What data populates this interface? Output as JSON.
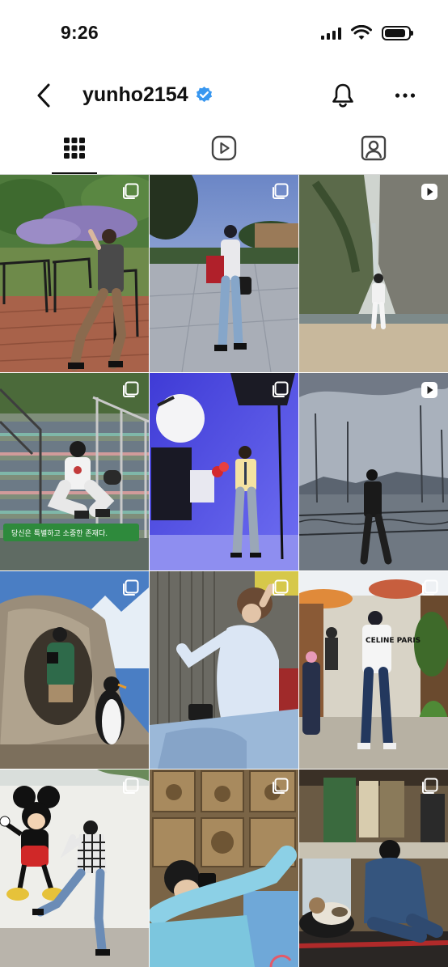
{
  "status_bar": {
    "time": "9:26",
    "battery_level": 0.9
  },
  "header": {
    "username": "yunho2154",
    "verified": true
  },
  "tabs": [
    {
      "name": "posts-grid",
      "icon": "grid-icon",
      "active": true
    },
    {
      "name": "reels",
      "icon": "reels-icon",
      "active": false
    },
    {
      "name": "tagged",
      "icon": "tagged-person-icon",
      "active": false
    }
  ],
  "posts": [
    {
      "type": "carousel",
      "scene": "garden terrace with lavender bushes, man in sunglasses and brown flared pants beside iron chairs"
    },
    {
      "type": "carousel",
      "scene": "plaza at dusk, man in white tee and jeans holding red bag"
    },
    {
      "type": "reel",
      "scene": "rocky gorge with waterfall, man in white outfit standing on sand"
    },
    {
      "type": "carousel",
      "scene": "man in white shirt and cap crouching on colorful stairs",
      "sign_text": "당신은 특별하고 소중한 존재다."
    },
    {
      "type": "carousel",
      "scene": "studio with blue backdrop, softbox light, man in yellow shirt and tie holding flowers"
    },
    {
      "type": "reel",
      "scene": "marina with sailboat masts, man in black walking"
    },
    {
      "type": "carousel",
      "scene": "penguin exhibit with rock cave, man in green sweater holding camera"
    },
    {
      "type": "carousel",
      "scene": "man in light blue shirt with camera, hand on head, against wood panels"
    },
    {
      "type": "carousel",
      "scene": "alley with umbrellas, man in Celine Paris tee and jeans",
      "shirt_text": "CELINE PARIS"
    },
    {
      "type": "carousel",
      "scene": "Mickey Mouse mural wall, man in plaid shirt posing"
    },
    {
      "type": "carousel",
      "scene": "handprint wall, man in black beanie and blue jacket holding camera"
    },
    {
      "type": "carousel",
      "scene": "shop with wooden signage, man in denim sitting with a cat"
    }
  ],
  "colors": {
    "text": "#111111",
    "verified_blue": "#3897f0",
    "divider": "#dbdbdb"
  }
}
